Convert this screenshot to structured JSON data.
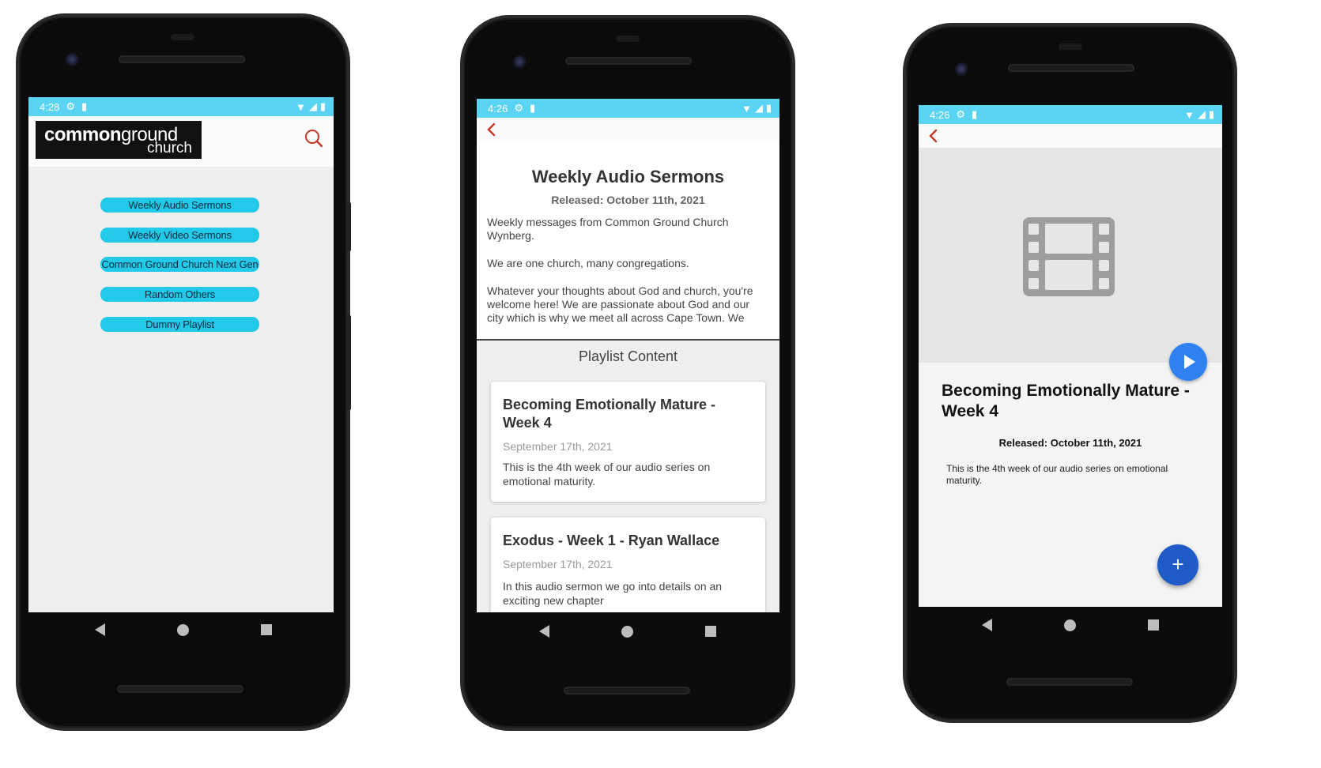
{
  "phone1": {
    "status_time": "4:28",
    "logo_bold": "common",
    "logo_light": "ground",
    "logo_sub": "church",
    "menu": [
      "Weekly Audio Sermons",
      "Weekly Video Sermons",
      "Common Ground Church Next Gen",
      "Random Others",
      "Dummy Playlist"
    ]
  },
  "phone2": {
    "status_time": "4:26",
    "title": "Weekly Audio Sermons",
    "released": "Released: October 11th, 2021",
    "description": [
      "Weekly messages from Common Ground Church Wynberg.",
      "We are one church, many congregations.",
      "Whatever your thoughts about God and church, you're welcome here! We are passionate about God and our city which is why we meet all across Cape Town. We"
    ],
    "playlist_heading": "Playlist Content",
    "cards": [
      {
        "title": "Becoming Emotionally Mature - Week 4",
        "date": "September 17th, 2021",
        "text": "This is the 4th week of our audio series on emotional maturity."
      },
      {
        "title": "Exodus - Week 1 - Ryan Wallace",
        "date": "September 17th, 2021",
        "text": "In this audio sermon we go into details on an exciting new chapter"
      }
    ]
  },
  "phone3": {
    "status_time": "4:26",
    "title": "Becoming Emotionally Mature - Week 4",
    "released": "Released: October 11th, 2021",
    "description": "This is the 4th week of our audio series on emotional maturity.",
    "fab_label": "+"
  },
  "colors": {
    "status_bar": "#5bd3f2",
    "menu_pill": "#22c9e8",
    "accent_red": "#c0392b",
    "play_button": "#2f80f0",
    "fab": "#1f5bc6"
  },
  "icons": {
    "status": [
      "settings-icon",
      "sd-card-icon",
      "wifi-icon",
      "signal-icon",
      "battery-icon"
    ],
    "nav": [
      "back-icon",
      "home-icon",
      "recents-icon"
    ],
    "search": "search-icon",
    "back": "chevron-left-icon",
    "media": "film-icon",
    "play": "play-icon"
  }
}
